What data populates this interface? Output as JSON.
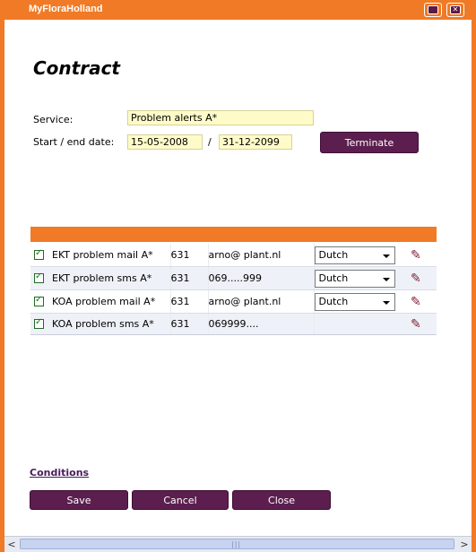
{
  "window": {
    "title": "MyFloraHolland"
  },
  "page": {
    "heading": "Contract"
  },
  "form": {
    "service_label": "Service:",
    "service_value": "Problem alerts A*",
    "date_label": "Start / end date:",
    "start_date": "15-05-2008",
    "separator": "/",
    "end_date": "31-12-2099",
    "terminate_label": "Terminate"
  },
  "grid": {
    "rows": [
      {
        "checked": true,
        "name": "EKT problem mail A*",
        "num": "631",
        "contact": "arno@ plant.nl",
        "language": "Dutch",
        "has_language": true
      },
      {
        "checked": true,
        "name": "EKT problem sms A*",
        "num": "631",
        "contact": "069.....999",
        "language": "Dutch",
        "has_language": true
      },
      {
        "checked": true,
        "name": "KOA problem mail A*",
        "num": "631",
        "contact": "arno@ plant.nl",
        "language": "Dutch",
        "has_language": true
      },
      {
        "checked": true,
        "name": "KOA problem sms A*",
        "num": "631",
        "contact": "069999....",
        "language": "",
        "has_language": false
      }
    ]
  },
  "footer": {
    "conditions_label": "Conditions",
    "save_label": "Save",
    "cancel_label": "Cancel",
    "close_label": "Close"
  },
  "icons": {
    "restore": "restore-icon",
    "close": "close-icon",
    "edit": "pencil-icon"
  },
  "colors": {
    "accent_orange": "#f07a26",
    "button_purple": "#5b1e4e",
    "field_yellow": "#fffbc8"
  }
}
